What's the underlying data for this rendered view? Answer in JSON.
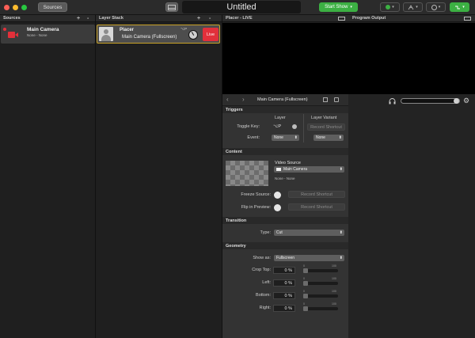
{
  "toolbar": {
    "sources_button": "Sources",
    "document_title": "Untitled",
    "start_show_label": "Start Show",
    "layout_icon": "layout-icon",
    "colors": {
      "green": "#3cb043",
      "close": "#fe5f57",
      "minimize": "#febc2e",
      "zoom": "#28c840"
    }
  },
  "sources": {
    "header": "Sources",
    "add": "+",
    "remove": "-",
    "item": {
      "name": "Main Camera",
      "subtitle": "None - None"
    }
  },
  "layer_stack": {
    "header": "Layer Stack",
    "add": "+",
    "remove": "-",
    "item": {
      "name": "Placer",
      "source": "Main Camera (Fullscreen)",
      "shortcut": "⌥P",
      "live_label": "Live"
    }
  },
  "preview": {
    "header": "Placer - LIVE"
  },
  "program": {
    "header": "Program Output"
  },
  "inspector": {
    "title": "Main Camera (Fullscreen)",
    "back": "‹",
    "forward": "›",
    "triggers": {
      "header": "Triggers",
      "layer_col": "Layer",
      "variant_col": "Layer Variant",
      "toggle_key_label": "Toggle Key:",
      "toggle_key_value": "⌥P",
      "record_shortcut": "Record Shortcut",
      "event_label": "Event:",
      "event_value": "None",
      "variant_event_value": "None"
    },
    "content": {
      "header": "Content",
      "video_source_label": "Video Source",
      "video_source_value": "Main Camera",
      "source_detail": "None - None",
      "freeze_label": "Freeze Source:",
      "freeze_shortcut": "Record Shortcut",
      "flip_label": "Flip in Preview:",
      "flip_shortcut": "Record Shortcut"
    },
    "transition": {
      "header": "Transition",
      "type_label": "Type:",
      "type_value": "Cut"
    },
    "geometry": {
      "header": "Geometry",
      "show_as_label": "Show as:",
      "show_as_value": "Fullscreen",
      "crops": [
        {
          "label": "Crop Top:",
          "value": "0 %",
          "min": "0",
          "max": "100",
          "fraction": 0
        },
        {
          "label": "Left:",
          "value": "0 %",
          "min": "0",
          "max": "100",
          "fraction": 0
        },
        {
          "label": "Bottom:",
          "value": "0 %",
          "min": "0",
          "max": "100",
          "fraction": 0
        },
        {
          "label": "Right:",
          "value": "0 %",
          "min": "0",
          "max": "100",
          "fraction": 0
        }
      ]
    }
  }
}
